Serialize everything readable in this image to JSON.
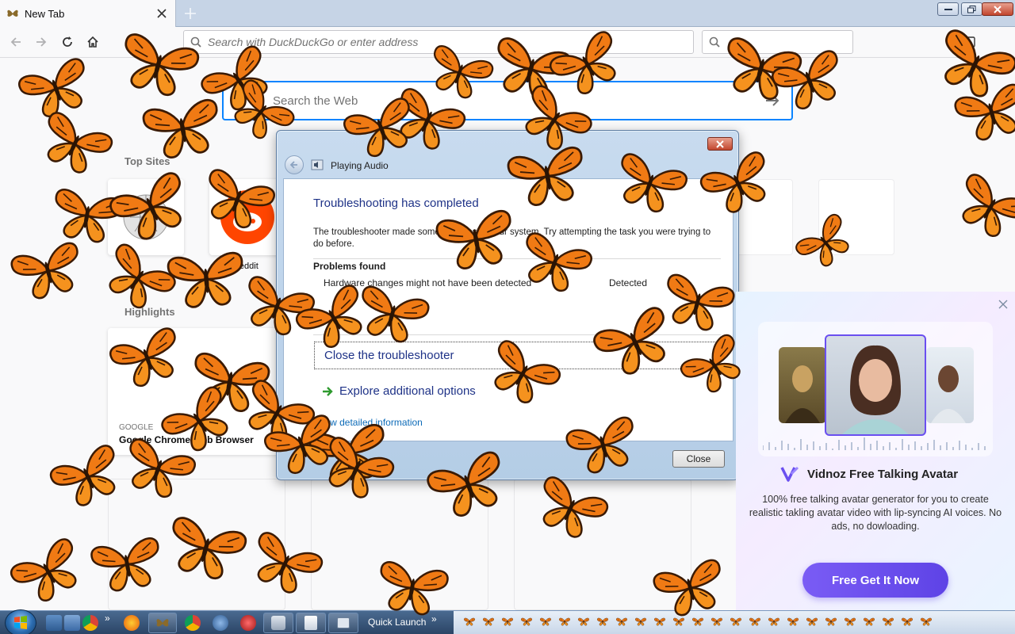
{
  "browser": {
    "tab_title": "New Tab",
    "url_placeholder": "Search with DuckDuckGo or enter address",
    "search_placeholder": "Search"
  },
  "newtab": {
    "web_search_placeholder": "Search the Web",
    "top_sites_title": "Top Sites",
    "top_sites": [
      {
        "label": "",
        "icon": "wikipedia-icon"
      },
      {
        "label": "reddit",
        "icon": "reddit-icon"
      }
    ],
    "highlights_title": "Highlights",
    "highlight": {
      "source": "GOOGLE",
      "title": "Google Chrome Web Browser"
    }
  },
  "dialog": {
    "title": "Playing Audio",
    "heading": "Troubleshooting has completed",
    "description": "The troubleshooter made some changes to your system. Try attempting the task you were trying to do before.",
    "problems_title": "Problems found",
    "problem": "Hardware changes might not have been detected",
    "problem_status": "Detected",
    "option_close": "Close the troubleshooter",
    "option_explore": "Explore additional options",
    "details_link": "View detailed information",
    "close_button": "Close"
  },
  "ad": {
    "title": "Vidnoz Free Talking Avatar",
    "description": "100% free talking avatar generator for you to create realistic takling avatar video with lip-syncing AI voices. No ads, no dowloading.",
    "cta": "Free Get It Now",
    "accent": "#6a4ff0"
  },
  "taskbar": {
    "quick_launch": "Quick Launch",
    "chevron": "»"
  },
  "colors": {
    "butterfly_orange": "#f07a14",
    "focus_blue": "#0a84ff",
    "dialog_link": "#1e3287"
  }
}
